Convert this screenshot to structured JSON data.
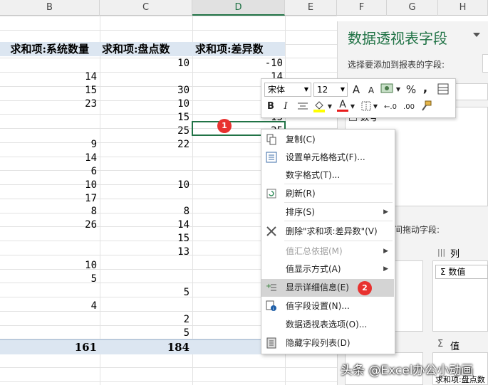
{
  "columns": [
    {
      "id": "B",
      "label": "B"
    },
    {
      "id": "C",
      "label": "C"
    },
    {
      "id": "D",
      "label": "D"
    },
    {
      "id": "E",
      "label": "E"
    },
    {
      "id": "F",
      "label": "F"
    },
    {
      "id": "G",
      "label": "G"
    },
    {
      "id": "H",
      "label": "H"
    }
  ],
  "pivot_headers": [
    "求和项:系统数量",
    "求和项:盘点数",
    "求和项:差异数"
  ],
  "rows": [
    {
      "b": "",
      "c": "10",
      "d": "-10"
    },
    {
      "b": "14",
      "c": "",
      "d": "14"
    },
    {
      "b": "15",
      "c": "30",
      "d": ""
    },
    {
      "b": "23",
      "c": "10",
      "d": ""
    },
    {
      "b": "",
      "c": "15",
      "d": "15"
    },
    {
      "b": "",
      "c": "25",
      "d": "25"
    },
    {
      "b": "9",
      "c": "22",
      "d": ""
    },
    {
      "b": "14",
      "c": "",
      "d": ""
    },
    {
      "b": "6",
      "c": "",
      "d": ""
    },
    {
      "b": "10",
      "c": "10",
      "d": ""
    },
    {
      "b": "17",
      "c": "",
      "d": ""
    },
    {
      "b": "8",
      "c": "8",
      "d": ""
    },
    {
      "b": "26",
      "c": "14",
      "d": ""
    },
    {
      "b": "",
      "c": "15",
      "d": ""
    },
    {
      "b": "",
      "c": "13",
      "d": ""
    },
    {
      "b": "10",
      "c": "",
      "d": ""
    },
    {
      "b": "5",
      "c": "",
      "d": ""
    },
    {
      "b": "",
      "c": "5",
      "d": ""
    },
    {
      "b": "4",
      "c": "",
      "d": ""
    },
    {
      "b": "",
      "c": "2",
      "d": ""
    },
    {
      "b": "",
      "c": "5",
      "d": ""
    }
  ],
  "totals": {
    "b": "161",
    "c": "184"
  },
  "panel": {
    "title": "数据透视表字段",
    "subtitle": "选择要添加到报表的字段:",
    "field_item": "数号",
    "drag_hint": "间拖动字段:",
    "columns_label": "列",
    "columns_value": "Σ 数值",
    "values_label": "值",
    "values_item": "求和项:盘点数",
    "sigma": "Σ",
    "columns_icon": "|||"
  },
  "mini_toolbar": {
    "font_name": "宋体",
    "font_size": "12",
    "grow": "A",
    "shrink": "A",
    "percent": "%",
    "comma": ",",
    "bold": "B",
    "italic": "I",
    "color_a": "A",
    "decimals_up": "←.0",
    "decimals_down": ".00"
  },
  "context_menu": [
    {
      "label": "复制(C)",
      "icon": "copy-icon",
      "enabled": true
    },
    {
      "label": "设置单元格格式(F)...",
      "icon": "format-cells-icon",
      "enabled": true
    },
    {
      "label": "数字格式(T)...",
      "icon": "",
      "enabled": true
    },
    {
      "label": "刷新(R)",
      "icon": "refresh-icon",
      "enabled": true
    },
    {
      "label": "排序(S)",
      "icon": "",
      "enabled": true,
      "submenu": true
    },
    {
      "label": "删除\"求和项:差异数\"(V)",
      "icon": "delete-x-icon",
      "enabled": true
    },
    {
      "label": "值汇总依据(M)",
      "icon": "",
      "enabled": false,
      "submenu": true
    },
    {
      "label": "值显示方式(A)",
      "icon": "",
      "enabled": true,
      "submenu": true
    },
    {
      "label": "显示详细信息(E)",
      "icon": "show-details-icon",
      "enabled": true,
      "highlighted": true
    },
    {
      "label": "值字段设置(N)...",
      "icon": "field-settings-icon",
      "enabled": true
    },
    {
      "label": "数据透视表选项(O)...",
      "icon": "",
      "enabled": true
    },
    {
      "label": "隐藏字段列表(D)",
      "icon": "hide-field-list-icon",
      "enabled": true
    }
  ],
  "badges": [
    "1",
    "2"
  ],
  "watermark": "头条 @Excel办公小动画",
  "colors": {
    "accent": "#217346",
    "header_fill": "#dce6f1",
    "badge": "#e8312f"
  }
}
